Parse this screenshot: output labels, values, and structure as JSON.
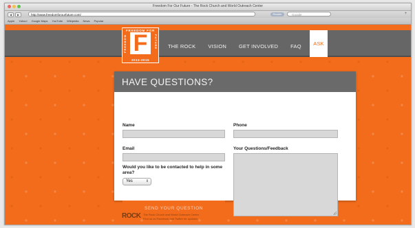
{
  "browser": {
    "window_title": "Freedom For Our Future - The Rock Church and World Outreach Center",
    "url": "http://www.freedomforourfuture.com/",
    "reader_label": "Reader",
    "search_placeholder": "Google",
    "nav_back": "◀",
    "nav_forward": "▶",
    "plus": "+",
    "bookmarks": [
      "Apple",
      "Yahoo!",
      "Google Maps",
      "YouTube",
      "Wikipedia",
      "News",
      "Popular"
    ]
  },
  "site": {
    "logo": {
      "top": "FREEDOM FOR OUR",
      "left": "FREEDOM",
      "right": "FUTURE",
      "letter": "F",
      "bottom": "2013-2015"
    },
    "nav": [
      {
        "label": "THE ROCK"
      },
      {
        "label": "VISION"
      },
      {
        "label": "GET INVOLVED"
      },
      {
        "label": "FAQ"
      }
    ],
    "nav_active": "ASK"
  },
  "form": {
    "title": "HAVE QUESTIONS?",
    "name_label": "Name",
    "phone_label": "Phone",
    "email_label": "Email",
    "feedback_label": "Your Questions/Feedback",
    "contact_question": "Would you like to be contacted to help in some area?",
    "contact_value": "Yes",
    "submit_label": "SEND YOUR QUESTION"
  },
  "footer": {
    "logo": "ROCK",
    "line1": "The Rock Church and World Outreach Center",
    "line2": "Find us on Facebook and Twitter for updates"
  }
}
